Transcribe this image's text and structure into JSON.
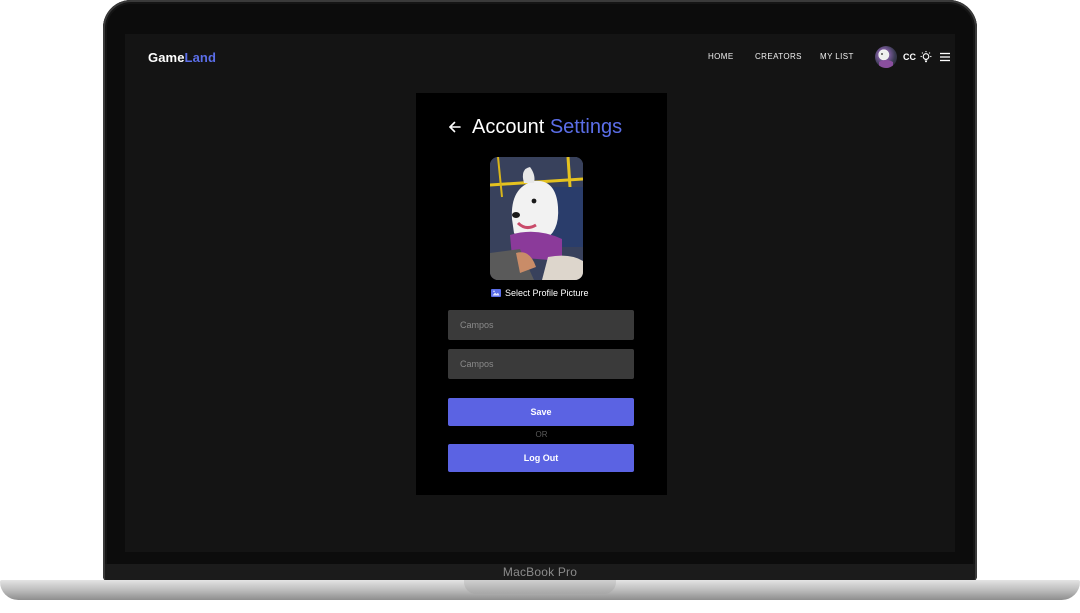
{
  "device": {
    "label": "MacBook Pro"
  },
  "header": {
    "brand_primary": "Game",
    "brand_accent": "Land",
    "nav": [
      {
        "label": "HOME"
      },
      {
        "label": "CREATORS"
      },
      {
        "label": "MY LIST"
      }
    ],
    "user_initials": "CC",
    "icons": [
      "avatar",
      "lightbulb-icon",
      "menu-icon"
    ]
  },
  "settings": {
    "title_primary": "Account",
    "title_accent": "Settings",
    "select_picture_label": "Select Profile Picture",
    "first_name_placeholder": "Campos",
    "last_name_placeholder": "Campos",
    "save_label": "Save",
    "separator": "OR",
    "logout_label": "Log Out"
  },
  "colors": {
    "accent": "#5b6ee8",
    "button": "#5b63e3",
    "background": "#141414",
    "panel": "#000000"
  }
}
